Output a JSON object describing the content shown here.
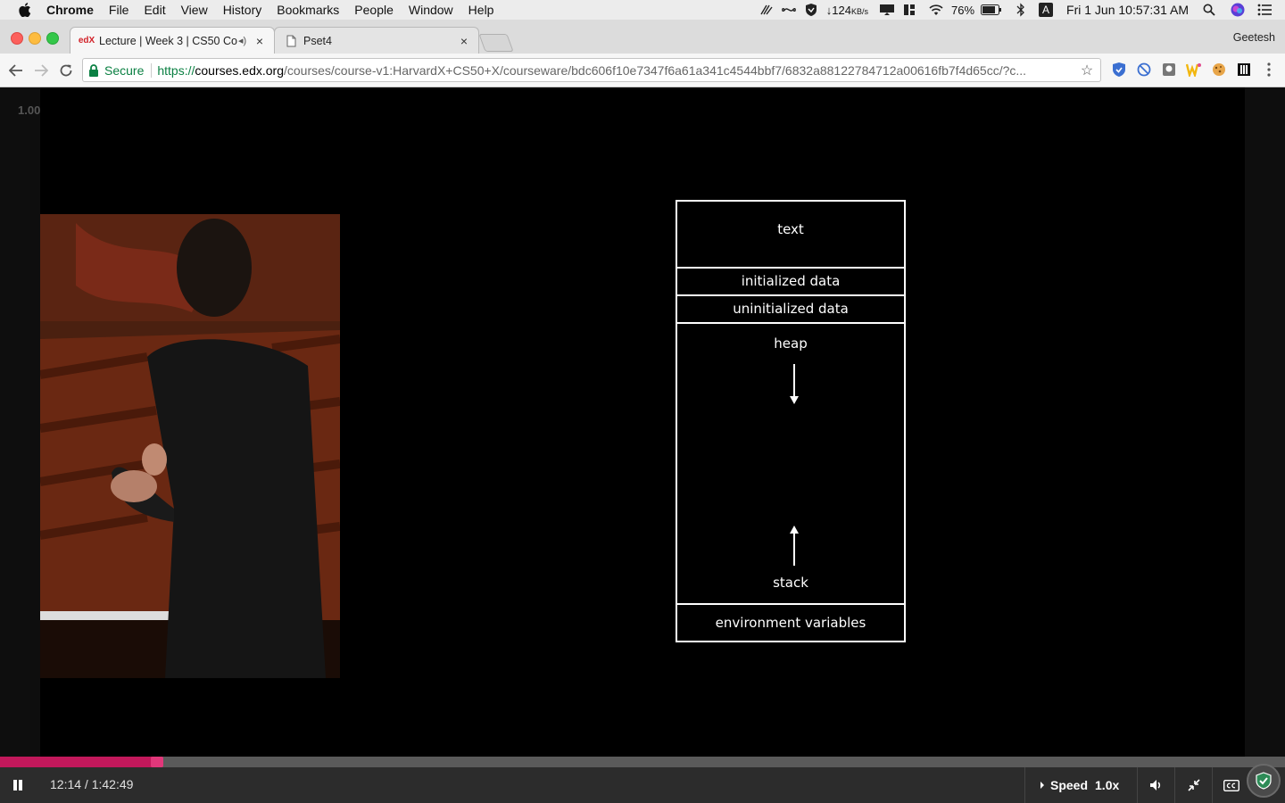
{
  "menubar": {
    "app_name": "Chrome",
    "items": [
      "File",
      "Edit",
      "View",
      "History",
      "Bookmarks",
      "People",
      "Window",
      "Help"
    ],
    "net_speed": "↓124",
    "net_unit": "KB/s",
    "battery": "76%",
    "input_source": "A",
    "clock": "Fri 1 Jun  10:57:31 AM"
  },
  "tabs": [
    {
      "title": "Lecture | Week 3 | CS50 Co",
      "favicon": "edX",
      "audio": "◂)"
    },
    {
      "title": "Pset4",
      "favicon": "document-icon"
    }
  ],
  "profile_name": "Geetesh",
  "toolbar": {
    "secure_label": "Secure",
    "url_scheme": "https://",
    "url_host": "courses.edx.org",
    "url_path": "/courses/course-v1:HarvardX+CS50+X/courseware/bdc606f10e7347f6a61a341c4544bbf7/6832a88122784712a00616fb7f4d65cc/?c..."
  },
  "video": {
    "playback_rate_badge": "1.00",
    "time_display": "12:14 / 1:42:49",
    "progress_fraction": 0.119,
    "speed_label": "Speed",
    "speed_value": "1.0x"
  },
  "slide": {
    "segments": [
      "text",
      "initialized data",
      "uninitialized data",
      "heap",
      "stack",
      "environment variables"
    ]
  },
  "colors": {
    "progress_played": "#c2185b",
    "progress_handle": "#e1377a",
    "secure_green": "#0b8043"
  }
}
